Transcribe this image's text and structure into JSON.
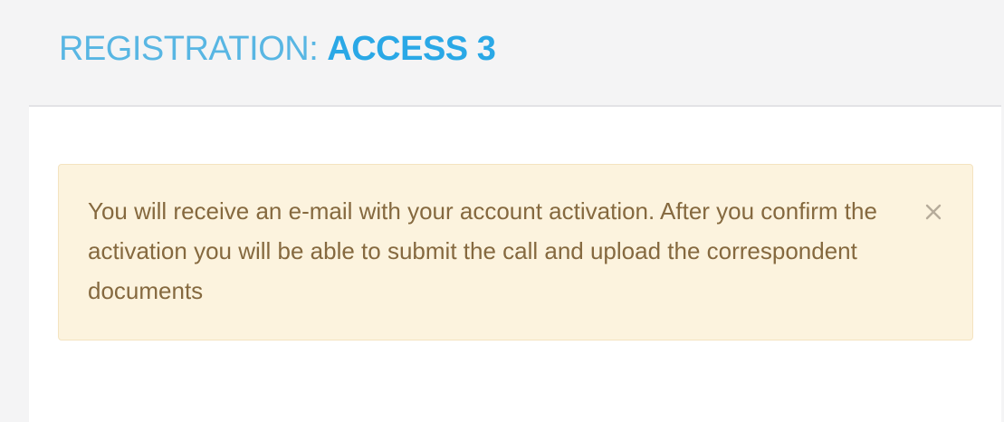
{
  "header": {
    "title_prefix": "REGISTRATION:",
    "title_emphasis": "ACCESS 3"
  },
  "alert": {
    "message": "You will receive an e-mail with your account activation. After you confirm the activation you will be able to submit the call and upload the correspondent documents",
    "close_icon": "close-icon"
  },
  "colors": {
    "title_light": "#58b6e3",
    "title_bold": "#2aa8e6",
    "alert_bg": "#fcf3de",
    "alert_border": "#f4e3c0",
    "alert_text": "#85693f"
  }
}
